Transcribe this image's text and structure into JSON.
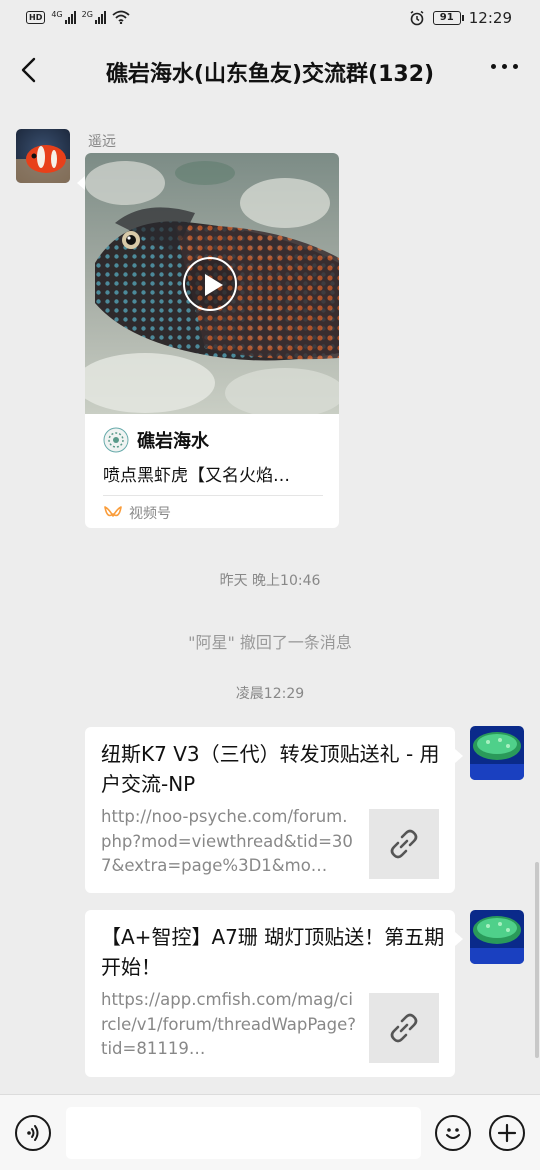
{
  "status_bar": {
    "hd_label": "HD",
    "sim1_label": "4G",
    "sim2_label": "2G",
    "battery": "91",
    "time": "12:29"
  },
  "header": {
    "title": "礁岩海水(山东鱼友)交流群(132)"
  },
  "messages": {
    "video_msg": {
      "sender": "遥远",
      "channel_name": "礁岩海水",
      "description": "喷点黑虾虎【又名火焰…",
      "source_label": "视频号"
    },
    "time_1": "昨天 晚上10:46",
    "recall_notice": "\"阿星\" 撤回了一条消息",
    "time_2": "凌晨12:29",
    "link_1": {
      "title": "纽斯K7 V3（三代）转发顶贴送礼 - 用户交流-NP",
      "url": "http://noo-psyche.com/forum.php?mod=viewthread&tid=307&extra=page%3D1&mo…"
    },
    "link_2": {
      "title": "【A+智控】A7珊 瑚灯顶贴送！第五期开始！",
      "url": "https://app.cmfish.com/mag/circle/v1/forum/threadWapPage?tid=81119…"
    }
  },
  "input_bar": {
    "value": ""
  },
  "icons": {
    "back": "chevron-left-icon",
    "more": "more-dots-icon",
    "play": "play-icon",
    "link": "link-icon",
    "voice": "voice-icon",
    "emoji": "emoji-icon",
    "add": "plus-icon",
    "channels": "channels-icon"
  },
  "colors": {
    "background": "#ededed",
    "bubble": "#ffffff",
    "muted_text": "#888888",
    "channels_accent": "#fa9d3b"
  }
}
